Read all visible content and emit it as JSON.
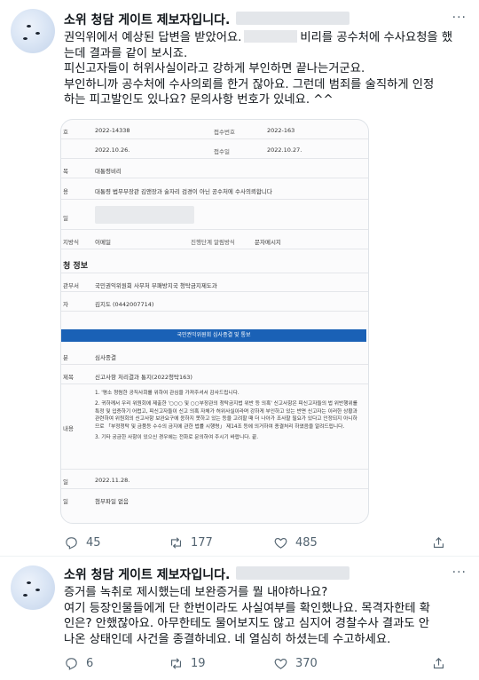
{
  "tweets": [
    {
      "author_name": "소위 청담 게이트 제보자입니다.",
      "more_label": "···",
      "lines": [
        "권익위에서 예상된 답변을 받았어요.",
        "비리를 공수처에 수사요청을 했",
        "는데 결과를 같이 보시죠.",
        "피신고자들이 허위사실이라고 강하게 부인하면 끝나는거군요.",
        "부인하니까 공수처에 수사의뢰를 한거 잖아요. 그런데 범죄를 술직하게  인정",
        "하는 피고발인도 있나요? 문의사항 번호가 있네요. ^^"
      ],
      "replies": "45",
      "retweets": "177",
      "likes": "485"
    },
    {
      "author_name": "소위 청담 게이트 제보자입니다.",
      "more_label": "···",
      "lines": [
        "증거를 녹취로 제시했는데 보완증거를 뭘 내야하나요?",
        "여기 등장인물들에게 단 한번이라도 사실여부를 확인했나요. 목격자한테 확",
        "인은? 안했잖아요. 아무한테도 물어보지도 않고 심지어 경찰수사 결과도 안",
        "나온 상태인데 사건을 종결하네요. 네 열심히 하셨는데 수고하세요."
      ],
      "replies": "6",
      "retweets": "19",
      "likes": "370"
    }
  ],
  "doc": {
    "label_1": "호",
    "receipt_no": "2022-14338",
    "label_receipt_num": "접수번호",
    "receipt_num_val": "2022-163",
    "date_1": "2022.10.26.",
    "label_receipt_date": "접수일",
    "receipt_date_val": "2022.10.27.",
    "label_title": "목",
    "title_val": "대통령비리",
    "label_content": "용",
    "content_val": "대통령 법무부장관 김앤장과 술자리 검경이 아닌 공수처에 수사의뢰합니다",
    "label_field": "일",
    "label_method": "지방식",
    "method_val": "이메일",
    "label_stage": "진행단계 알림방식",
    "stage_val": "문자메시지",
    "section": "청 정보",
    "label_dept": "관부서",
    "dept_val": "국민권익위원회 사무처 부패방지국 청탁금지제도과",
    "label_person": "자",
    "person_val": "김지도 (0442007714)",
    "bar_title": "국민권익위원회 심사종결 및 통보",
    "label_type": "분",
    "type_val": "심사종결",
    "label_subject": "제목",
    "subject_val": "신고사항 처리결과 통지(2022청탁163)",
    "label_body": "내용",
    "body_1": "1. '평소 청렴한 공직사회를 위하여 관심을 가져주셔서 감사드립니다.",
    "body_2": "2. 귀하께서 우리 위원회에 제출한 '○○○ 및 ○○부장관의 청탁금지법 위반 등 의혹' 신고사항은 피신고자들의 법 위반행위를 특정 및 입증하기 어렵고, 피신고자들이 신고 의혹 자체가 허위사실이라며 강하게 부인하고 있는 반면 신고자는 이러한 상황과 관련하여 위원회의 신고사항 보완요구에 응하지 못하고 있는 등을 고려할 때 더 나아가 조사할 필요가 있다고 인정되지 아니하므로 「부정청탁 및 금품등 수수의 금지에 관한 법률 시행령」 제14조 등에 의거하여 종결처리 하였음을 알려드립니다.",
    "body_3": "3. 기타 궁금한 사항이 있으신 경우에는 전화로 문의하여 주시기 바랍니다. 끝.",
    "label_date2": "일",
    "date_2": "2022.11.28.",
    "label_attach": "일",
    "attach_val": "첨부파일 없음"
  },
  "icons": {
    "reply": "reply-icon",
    "retweet": "retweet-icon",
    "like": "like-icon",
    "share": "share-icon",
    "more": "more-icon"
  },
  "colors": {
    "icon_gray": "#536471",
    "bar_blue": "#1a61b6"
  }
}
